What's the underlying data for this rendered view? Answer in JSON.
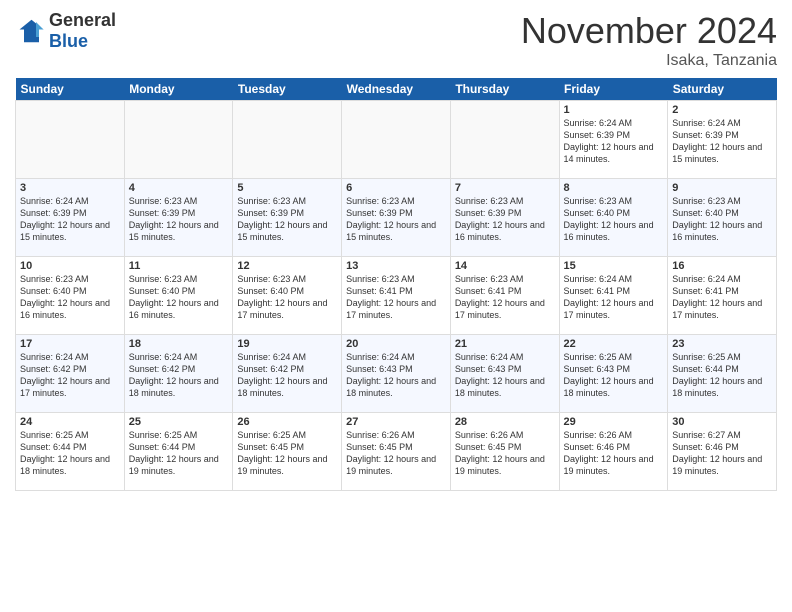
{
  "header": {
    "logo_general": "General",
    "logo_blue": "Blue",
    "month_title": "November 2024",
    "location": "Isaka, Tanzania"
  },
  "days_of_week": [
    "Sunday",
    "Monday",
    "Tuesday",
    "Wednesday",
    "Thursday",
    "Friday",
    "Saturday"
  ],
  "weeks": [
    [
      {
        "day": "",
        "empty": true
      },
      {
        "day": "",
        "empty": true
      },
      {
        "day": "",
        "empty": true
      },
      {
        "day": "",
        "empty": true
      },
      {
        "day": "",
        "empty": true
      },
      {
        "day": "1",
        "sunrise": "Sunrise: 6:24 AM",
        "sunset": "Sunset: 6:39 PM",
        "daylight": "Daylight: 12 hours and 14 minutes."
      },
      {
        "day": "2",
        "sunrise": "Sunrise: 6:24 AM",
        "sunset": "Sunset: 6:39 PM",
        "daylight": "Daylight: 12 hours and 15 minutes."
      }
    ],
    [
      {
        "day": "3",
        "sunrise": "Sunrise: 6:24 AM",
        "sunset": "Sunset: 6:39 PM",
        "daylight": "Daylight: 12 hours and 15 minutes."
      },
      {
        "day": "4",
        "sunrise": "Sunrise: 6:23 AM",
        "sunset": "Sunset: 6:39 PM",
        "daylight": "Daylight: 12 hours and 15 minutes."
      },
      {
        "day": "5",
        "sunrise": "Sunrise: 6:23 AM",
        "sunset": "Sunset: 6:39 PM",
        "daylight": "Daylight: 12 hours and 15 minutes."
      },
      {
        "day": "6",
        "sunrise": "Sunrise: 6:23 AM",
        "sunset": "Sunset: 6:39 PM",
        "daylight": "Daylight: 12 hours and 15 minutes."
      },
      {
        "day": "7",
        "sunrise": "Sunrise: 6:23 AM",
        "sunset": "Sunset: 6:39 PM",
        "daylight": "Daylight: 12 hours and 16 minutes."
      },
      {
        "day": "8",
        "sunrise": "Sunrise: 6:23 AM",
        "sunset": "Sunset: 6:40 PM",
        "daylight": "Daylight: 12 hours and 16 minutes."
      },
      {
        "day": "9",
        "sunrise": "Sunrise: 6:23 AM",
        "sunset": "Sunset: 6:40 PM",
        "daylight": "Daylight: 12 hours and 16 minutes."
      }
    ],
    [
      {
        "day": "10",
        "sunrise": "Sunrise: 6:23 AM",
        "sunset": "Sunset: 6:40 PM",
        "daylight": "Daylight: 12 hours and 16 minutes."
      },
      {
        "day": "11",
        "sunrise": "Sunrise: 6:23 AM",
        "sunset": "Sunset: 6:40 PM",
        "daylight": "Daylight: 12 hours and 16 minutes."
      },
      {
        "day": "12",
        "sunrise": "Sunrise: 6:23 AM",
        "sunset": "Sunset: 6:40 PM",
        "daylight": "Daylight: 12 hours and 17 minutes."
      },
      {
        "day": "13",
        "sunrise": "Sunrise: 6:23 AM",
        "sunset": "Sunset: 6:41 PM",
        "daylight": "Daylight: 12 hours and 17 minutes."
      },
      {
        "day": "14",
        "sunrise": "Sunrise: 6:23 AM",
        "sunset": "Sunset: 6:41 PM",
        "daylight": "Daylight: 12 hours and 17 minutes."
      },
      {
        "day": "15",
        "sunrise": "Sunrise: 6:24 AM",
        "sunset": "Sunset: 6:41 PM",
        "daylight": "Daylight: 12 hours and 17 minutes."
      },
      {
        "day": "16",
        "sunrise": "Sunrise: 6:24 AM",
        "sunset": "Sunset: 6:41 PM",
        "daylight": "Daylight: 12 hours and 17 minutes."
      }
    ],
    [
      {
        "day": "17",
        "sunrise": "Sunrise: 6:24 AM",
        "sunset": "Sunset: 6:42 PM",
        "daylight": "Daylight: 12 hours and 17 minutes."
      },
      {
        "day": "18",
        "sunrise": "Sunrise: 6:24 AM",
        "sunset": "Sunset: 6:42 PM",
        "daylight": "Daylight: 12 hours and 18 minutes."
      },
      {
        "day": "19",
        "sunrise": "Sunrise: 6:24 AM",
        "sunset": "Sunset: 6:42 PM",
        "daylight": "Daylight: 12 hours and 18 minutes."
      },
      {
        "day": "20",
        "sunrise": "Sunrise: 6:24 AM",
        "sunset": "Sunset: 6:43 PM",
        "daylight": "Daylight: 12 hours and 18 minutes."
      },
      {
        "day": "21",
        "sunrise": "Sunrise: 6:24 AM",
        "sunset": "Sunset: 6:43 PM",
        "daylight": "Daylight: 12 hours and 18 minutes."
      },
      {
        "day": "22",
        "sunrise": "Sunrise: 6:25 AM",
        "sunset": "Sunset: 6:43 PM",
        "daylight": "Daylight: 12 hours and 18 minutes."
      },
      {
        "day": "23",
        "sunrise": "Sunrise: 6:25 AM",
        "sunset": "Sunset: 6:44 PM",
        "daylight": "Daylight: 12 hours and 18 minutes."
      }
    ],
    [
      {
        "day": "24",
        "sunrise": "Sunrise: 6:25 AM",
        "sunset": "Sunset: 6:44 PM",
        "daylight": "Daylight: 12 hours and 18 minutes."
      },
      {
        "day": "25",
        "sunrise": "Sunrise: 6:25 AM",
        "sunset": "Sunset: 6:44 PM",
        "daylight": "Daylight: 12 hours and 19 minutes."
      },
      {
        "day": "26",
        "sunrise": "Sunrise: 6:25 AM",
        "sunset": "Sunset: 6:45 PM",
        "daylight": "Daylight: 12 hours and 19 minutes."
      },
      {
        "day": "27",
        "sunrise": "Sunrise: 6:26 AM",
        "sunset": "Sunset: 6:45 PM",
        "daylight": "Daylight: 12 hours and 19 minutes."
      },
      {
        "day": "28",
        "sunrise": "Sunrise: 6:26 AM",
        "sunset": "Sunset: 6:45 PM",
        "daylight": "Daylight: 12 hours and 19 minutes."
      },
      {
        "day": "29",
        "sunrise": "Sunrise: 6:26 AM",
        "sunset": "Sunset: 6:46 PM",
        "daylight": "Daylight: 12 hours and 19 minutes."
      },
      {
        "day": "30",
        "sunrise": "Sunrise: 6:27 AM",
        "sunset": "Sunset: 6:46 PM",
        "daylight": "Daylight: 12 hours and 19 minutes."
      }
    ]
  ]
}
